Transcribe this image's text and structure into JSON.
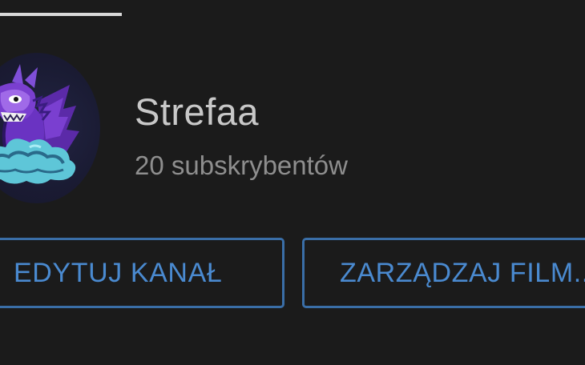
{
  "channel": {
    "name": "Strefaa",
    "subscribers": "20 subskrybentów"
  },
  "actions": {
    "edit_channel_label": "EDYTUJ KANAŁ",
    "manage_videos_label": "ZARZĄDZAJ FILM..."
  },
  "colors": {
    "background": "#1b1b1b",
    "accent": "#4a8ad0",
    "button_border": "#3a6ea7",
    "title_text": "#c8c8c8",
    "secondary_text": "#8e8e8e",
    "tab_indicator": "#d9d9d9"
  },
  "icons": {
    "avatar": "dragon-avatar-icon"
  }
}
